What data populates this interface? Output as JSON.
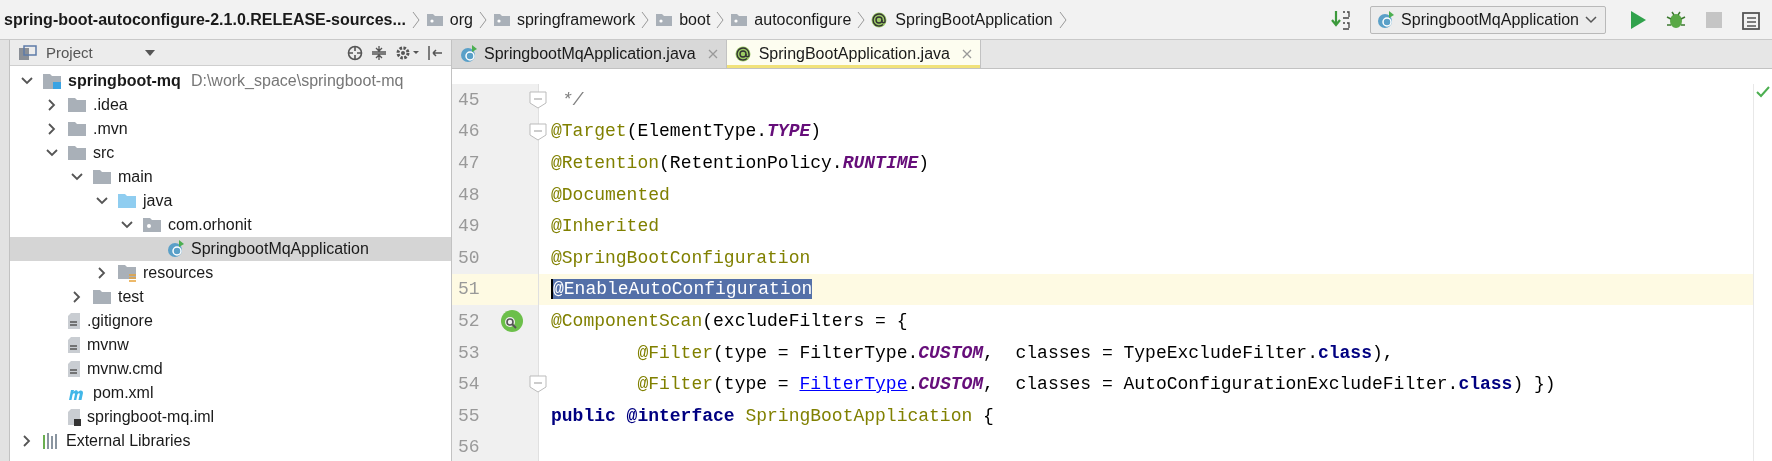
{
  "navigation_bar": {
    "breadcrumbs": [
      {
        "label": "spring-boot-autoconfigure-2.1.0.RELEASE-sources...",
        "kind": "archive"
      },
      {
        "label": "org",
        "kind": "package"
      },
      {
        "label": "springframework",
        "kind": "package"
      },
      {
        "label": "boot",
        "kind": "package"
      },
      {
        "label": "autoconfigure",
        "kind": "package"
      },
      {
        "label": "SpringBootApplication",
        "kind": "annotation"
      }
    ],
    "run_configuration": "SpringbootMqApplication",
    "actions": [
      {
        "kind": "build",
        "disabled": false
      },
      {
        "kind": "run",
        "disabled": false
      },
      {
        "kind": "debug",
        "disabled": false
      },
      {
        "kind": "stop",
        "disabled": true
      },
      {
        "kind": "structure",
        "disabled": false
      }
    ]
  },
  "project_panel": {
    "title": "Project",
    "tree": [
      {
        "label": "springboot-mq",
        "kind": "module",
        "hint": "D:\\work_space\\springboot-mq",
        "expanded": true,
        "selected": false,
        "children": [
          {
            "label": ".idea",
            "kind": "folder",
            "expanded": false,
            "selected": false
          },
          {
            "label": ".mvn",
            "kind": "folder",
            "expanded": false,
            "selected": false
          },
          {
            "label": "src",
            "kind": "folder",
            "expanded": true,
            "selected": false,
            "children": [
              {
                "label": "main",
                "kind": "folder",
                "expanded": true,
                "selected": false,
                "children": [
                  {
                    "label": "java",
                    "kind": "source-folder",
                    "expanded": true,
                    "selected": false,
                    "children": [
                      {
                        "label": "com.orhonit",
                        "kind": "package",
                        "expanded": true,
                        "selected": false,
                        "children": [
                          {
                            "label": "SpringbootMqApplication",
                            "kind": "spring-class",
                            "selected": true
                          }
                        ]
                      }
                    ]
                  },
                  {
                    "label": "resources",
                    "kind": "resource-folder",
                    "expanded": false,
                    "selected": false
                  }
                ]
              },
              {
                "label": "test",
                "kind": "folder",
                "expanded": false,
                "selected": false
              }
            ]
          },
          {
            "label": ".gitignore",
            "kind": "file",
            "selected": false
          },
          {
            "label": "mvnw",
            "kind": "file",
            "selected": false
          },
          {
            "label": "mvnw.cmd",
            "kind": "file",
            "selected": false
          },
          {
            "label": "pom.xml",
            "kind": "maven",
            "selected": false
          },
          {
            "label": "springboot-mq.iml",
            "kind": "module-file",
            "selected": false
          }
        ]
      },
      {
        "label": "External Libraries",
        "kind": "libraries",
        "expanded": false,
        "selected": false
      }
    ]
  },
  "editor_tabs": [
    {
      "label": "SpringbootMqApplication.java",
      "kind": "spring-class",
      "selected": false
    },
    {
      "label": "SpringBootApplication.java",
      "kind": "annotation",
      "selected": true
    }
  ],
  "editor": {
    "lines": [
      {
        "number": "45",
        "fold": true,
        "current": false,
        "tokens": [
          {
            "text": " */",
            "kind": "comment"
          }
        ]
      },
      {
        "number": "46",
        "fold": true,
        "current": false,
        "tokens": [
          {
            "text": "@Target",
            "kind": "annotation"
          },
          {
            "text": "(ElementType.",
            "kind": "plain"
          },
          {
            "text": "TYPE",
            "kind": "constant"
          },
          {
            "text": ")",
            "kind": "plain"
          }
        ]
      },
      {
        "number": "47",
        "fold": false,
        "current": false,
        "tokens": [
          {
            "text": "@Retention",
            "kind": "annotation"
          },
          {
            "text": "(RetentionPolicy.",
            "kind": "plain"
          },
          {
            "text": "RUNTIME",
            "kind": "constant"
          },
          {
            "text": ")",
            "kind": "plain"
          }
        ]
      },
      {
        "number": "48",
        "fold": false,
        "current": false,
        "tokens": [
          {
            "text": "@Documented",
            "kind": "annotation"
          }
        ]
      },
      {
        "number": "49",
        "fold": false,
        "current": false,
        "tokens": [
          {
            "text": "@Inherited",
            "kind": "annotation"
          }
        ]
      },
      {
        "number": "50",
        "fold": false,
        "current": false,
        "tokens": [
          {
            "text": "@SpringBootConfiguration",
            "kind": "annotation"
          }
        ]
      },
      {
        "number": "51",
        "fold": false,
        "current": true,
        "tokens": [
          {
            "text": "@EnableAutoConfiguration",
            "kind": "selection"
          }
        ]
      },
      {
        "number": "52",
        "fold": false,
        "current": false,
        "gutter_icon": true,
        "tokens": [
          {
            "text": "@ComponentScan",
            "kind": "annotation"
          },
          {
            "text": "(excludeFilters = {",
            "kind": "plain"
          }
        ]
      },
      {
        "number": "53",
        "fold": false,
        "current": false,
        "tokens": [
          {
            "text": "        @Filter",
            "kind": "annotation"
          },
          {
            "text": "(type = FilterType.",
            "kind": "plain"
          },
          {
            "text": "CUSTOM",
            "kind": "constant"
          },
          {
            "text": ",  classes = TypeExcludeFilter.",
            "kind": "plain"
          },
          {
            "text": "class",
            "kind": "keyword"
          },
          {
            "text": "),",
            "kind": "plain"
          }
        ]
      },
      {
        "number": "54",
        "fold": true,
        "current": false,
        "tokens": [
          {
            "text": "        @Filter",
            "kind": "annotation"
          },
          {
            "text": "(type = ",
            "kind": "plain"
          },
          {
            "text": "FilterType",
            "kind": "link"
          },
          {
            "text": ".",
            "kind": "plain"
          },
          {
            "text": "CUSTOM",
            "kind": "constant"
          },
          {
            "text": ",  classes = AutoConfigurationExcludeFilter.",
            "kind": "plain"
          },
          {
            "text": "class",
            "kind": "keyword"
          },
          {
            "text": ") })",
            "kind": "plain"
          }
        ]
      },
      {
        "number": "55",
        "fold": false,
        "current": false,
        "tokens": [
          {
            "text": "public @interface ",
            "kind": "keyword"
          },
          {
            "text": "SpringBootApplication",
            "kind": "declaration"
          },
          {
            "text": " {",
            "kind": "plain"
          }
        ]
      },
      {
        "number": "56",
        "fold": false,
        "current": false
      }
    ]
  }
}
